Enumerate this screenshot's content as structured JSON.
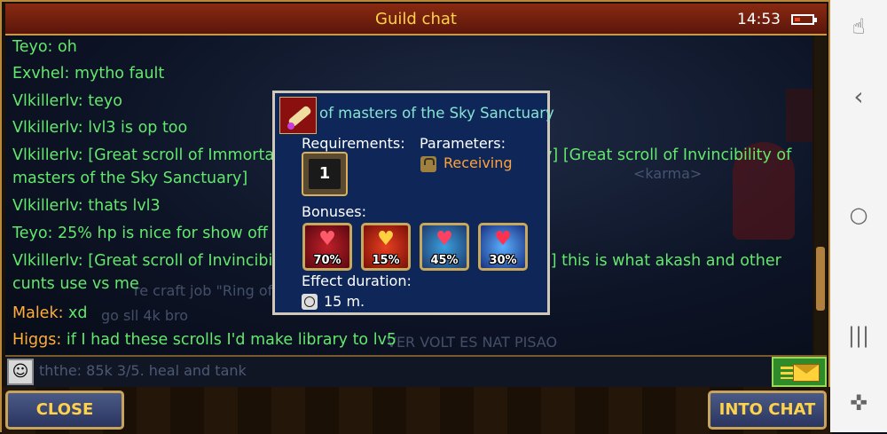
{
  "window": {
    "title": "Guild chat",
    "time": "14:53"
  },
  "chat": {
    "messages": [
      {
        "name": "Teyo:",
        "text": " oh",
        "color": "green"
      },
      {
        "name": "Exvhel:",
        "text": " mytho fault",
        "color": "green"
      },
      {
        "name": "Vlkillerlv:",
        "text": " teyo",
        "color": "green"
      },
      {
        "name": "Vlkillerlv:",
        "text": " lvl3 is op too",
        "color": "green"
      },
      {
        "name": "Vlkillerlv:",
        "text": " [Great scroll of Immortality of masters of the Sky Sanctuary] [Great scroll of Invincibility of masters of the Sky Sanctuary]",
        "color": "green"
      },
      {
        "name": "Vlkillerlv:",
        "text": " thats lvl3",
        "color": "green"
      },
      {
        "name": "Teyo:",
        "text": " 25% hp is nice for show off in tournaments",
        "color": "green"
      },
      {
        "name": "Vlkillerlv:",
        "text": " [Great scroll of Invincibility of masters of the Sky Sanctuary] this is what akash and other cunts use vs me",
        "color": "green"
      },
      {
        "name": "Malek:",
        "text": " xd",
        "color": "orange"
      },
      {
        "name": "Higgs:",
        "text": " if I had these scrolls I'd make library to lv5",
        "color": "orange"
      }
    ],
    "background_texts": {
      "karma": "<karma>",
      "craft": "re craft job \"Ring of",
      "go": "go sll 4k bro",
      "tail": "VER VOLT ES NAT PISAO"
    },
    "input_preview": "ththe: 85k 3/5. heal and tank"
  },
  "tooltip": {
    "title": "of masters of the Sky Sanctuary",
    "requirements_label": "Requirements:",
    "parameters_label": "Parameters:",
    "receiving": "Receiving",
    "level": "1",
    "bonuses_label": "Bonuses:",
    "bonuses": [
      {
        "icon": "heart-icon",
        "percent": "70%"
      },
      {
        "icon": "heart-cross-icon",
        "percent": "15%"
      },
      {
        "icon": "heart-shield-icon",
        "percent": "45%"
      },
      {
        "icon": "heart-orb-icon",
        "percent": "30%"
      }
    ],
    "effect_label": "Effect duration:",
    "duration": "15 m."
  },
  "buttons": {
    "close": "CLOSE",
    "into_chat": "INTO CHAT"
  },
  "battery_level": 0.35,
  "colors": {
    "green_text": "#62e86c",
    "orange_text": "#ffae3a",
    "title": "#ffd24a",
    "tooltip_title": "#86e3d2"
  }
}
